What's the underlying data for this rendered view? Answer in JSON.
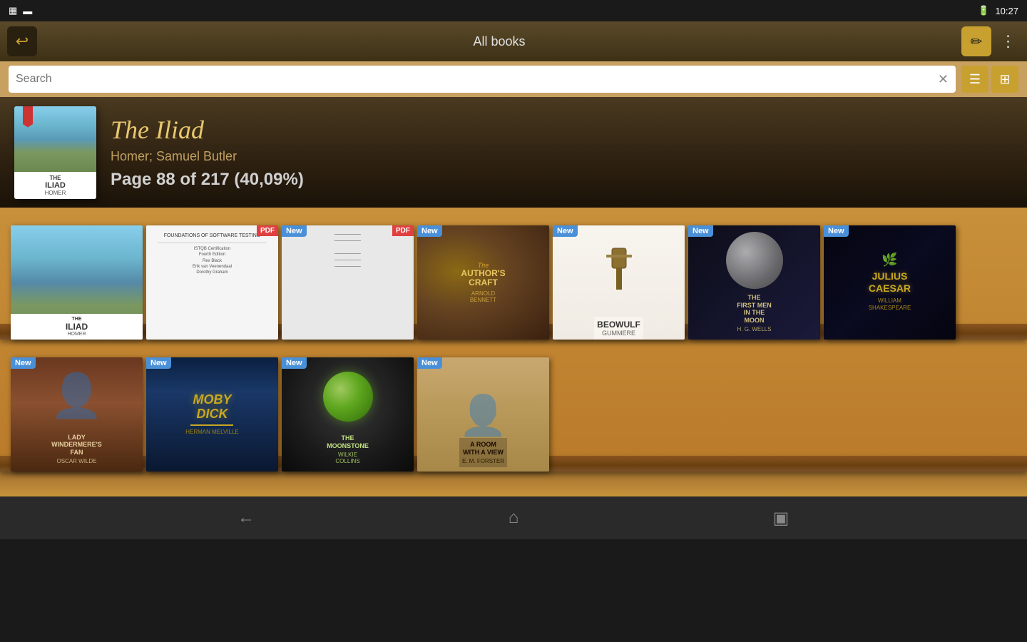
{
  "statusBar": {
    "leftIcons": [
      "grid-icon",
      "battery-icon"
    ],
    "time": "10:27",
    "batteryIcon": "🔋"
  },
  "topBar": {
    "backLabel": "↩",
    "title": "All books",
    "editLabel": "✏",
    "moreLabel": "⋮"
  },
  "searchBar": {
    "placeholder": "Search",
    "clearLabel": "✕",
    "listViewLabel": "☰",
    "gridViewLabel": "⊞"
  },
  "currentBook": {
    "title": "The Iliad",
    "author": "Homer; Samuel Butler",
    "progress": "Page 88 of 217 (40,09%)",
    "coverTitleLine1": "THE",
    "coverTitleLine2": "ILIAD",
    "coverAuthor": "HOMER"
  },
  "shelf1": {
    "books": [
      {
        "id": "iliad",
        "hasNew": false,
        "hasPDF": false,
        "title": "THE\nILIAD",
        "author": "HOMER",
        "coverType": "iliad"
      },
      {
        "id": "foundations",
        "hasNew": false,
        "hasPDF": true,
        "title": "FOUNDATIONS OF SOFTWARE TESTING",
        "author": "",
        "coverType": "foundations"
      },
      {
        "id": "unknown-pdf",
        "hasNew": true,
        "hasPDF": true,
        "title": "",
        "author": "",
        "coverType": "unknown"
      },
      {
        "id": "authors-craft",
        "hasNew": true,
        "hasPDF": false,
        "title": "THE\nAUTHOR'S\nCRAFT",
        "author": "ARNOLD\nBENNETT",
        "coverType": "authors-craft"
      },
      {
        "id": "beowulf",
        "hasNew": true,
        "hasPDF": false,
        "title": "BEOWULF",
        "author": "GUMMERE",
        "coverType": "beowulf"
      },
      {
        "id": "first-men",
        "hasNew": true,
        "hasPDF": false,
        "title": "THE\nFIRST MEN\nIN THE\nMOON",
        "author": "H. G. WELLS",
        "coverType": "first-men"
      },
      {
        "id": "julius-caesar",
        "hasNew": true,
        "hasPDF": false,
        "title": "JULIUS\nCAESAR",
        "author": "WILLIAM\nSHAKESPEARE",
        "coverType": "caesar"
      }
    ]
  },
  "shelf2": {
    "books": [
      {
        "id": "lady-windermeres",
        "hasNew": true,
        "hasPDF": false,
        "title": "LADY\nWINDERMERE'S\nFAN",
        "author": "OSCAR WILDE",
        "coverType": "lady"
      },
      {
        "id": "moby-dick",
        "hasNew": true,
        "hasPDF": false,
        "title": "MOBY\nDICK",
        "author": "HERMAN MELVILLE",
        "coverType": "moby-dick"
      },
      {
        "id": "moonstone",
        "hasNew": true,
        "hasPDF": false,
        "title": "THE\nMOONSTONE",
        "author": "WILKIE\nCOLLINS",
        "coverType": "moonstone"
      },
      {
        "id": "room-with-view",
        "hasNew": true,
        "hasPDF": false,
        "title": "A ROOM\nWITH\nA VIEW",
        "author": "E. M. FORSTER",
        "coverType": "room"
      }
    ]
  },
  "navBar": {
    "backLabel": "←",
    "homeLabel": "⌂",
    "recentLabel": "▣"
  }
}
